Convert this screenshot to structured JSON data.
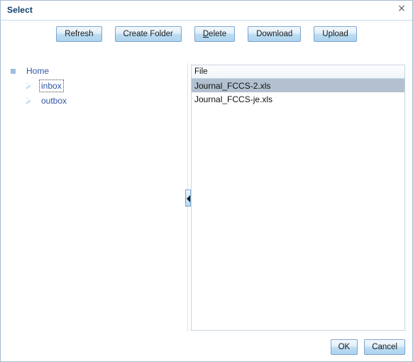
{
  "dialog": {
    "title": "Select",
    "close_label": "×"
  },
  "toolbar": {
    "buttons": [
      {
        "label": "Refresh",
        "name": "refresh-button",
        "accesskey": ""
      },
      {
        "label": "Create Folder",
        "name": "create-folder-button",
        "accesskey": ""
      },
      {
        "label": "Delete",
        "name": "delete-button",
        "accesskey": "D"
      },
      {
        "label": "Download",
        "name": "download-button",
        "accesskey": ""
      },
      {
        "label": "Upload",
        "name": "upload-button",
        "accesskey": ""
      }
    ]
  },
  "tree": {
    "nodes": [
      {
        "label": "Home",
        "level": 0,
        "state": "expanded",
        "focused": false
      },
      {
        "label": "inbox",
        "level": 1,
        "state": "collapsed",
        "focused": true
      },
      {
        "label": "outbox",
        "level": 1,
        "state": "collapsed",
        "focused": false
      }
    ]
  },
  "splitter": {
    "collapse_icon": "collapse-left-icon"
  },
  "file_table": {
    "columns": [
      "File"
    ],
    "rows": [
      {
        "file": "Journal_FCCS-2.xls",
        "selected": true
      },
      {
        "file": "Journal_FCCS-je.xls",
        "selected": false
      }
    ]
  },
  "footer": {
    "ok_label": "OK",
    "cancel_label": "Cancel"
  },
  "colors": {
    "title": "#0f3f6b",
    "button_border": "#7aa4cd",
    "button_face": "#aed4ef",
    "tree_link": "#2f57a6",
    "row_selected": "#b2c0d0",
    "panel_border": "#c7d5e3"
  }
}
